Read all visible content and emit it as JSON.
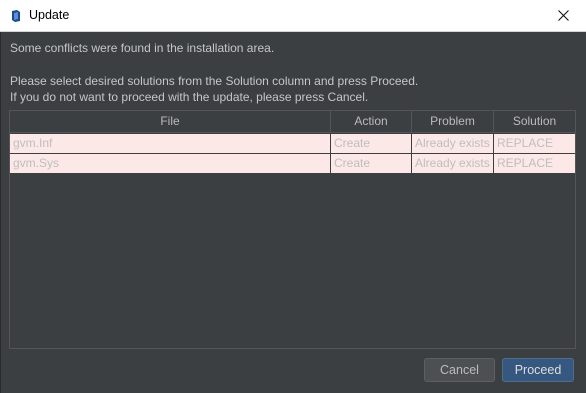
{
  "window": {
    "title": "Update"
  },
  "messages": {
    "line1": "Some conflicts were found in the installation area.",
    "line2": "Please select desired solutions from the Solution column and press Proceed.",
    "line3": "If you do not want to proceed with the update, please press Cancel."
  },
  "table": {
    "columns": [
      "File",
      "Action",
      "Problem",
      "Solution"
    ],
    "rows": [
      {
        "file": "gvm.Inf",
        "action": "Create",
        "problem": "Already exists",
        "solution": "REPLACE"
      },
      {
        "file": "gvm.Sys",
        "action": "Create",
        "problem": "Already exists",
        "solution": "REPLACE"
      }
    ]
  },
  "buttons": {
    "cancel": "Cancel",
    "proceed": "Proceed"
  },
  "colors": {
    "background": "#3c3f41",
    "row_conflict": "#fde8e8",
    "primary_button": "#365880"
  },
  "icons": {
    "app": "intellij-app-icon",
    "close": "close-icon"
  }
}
